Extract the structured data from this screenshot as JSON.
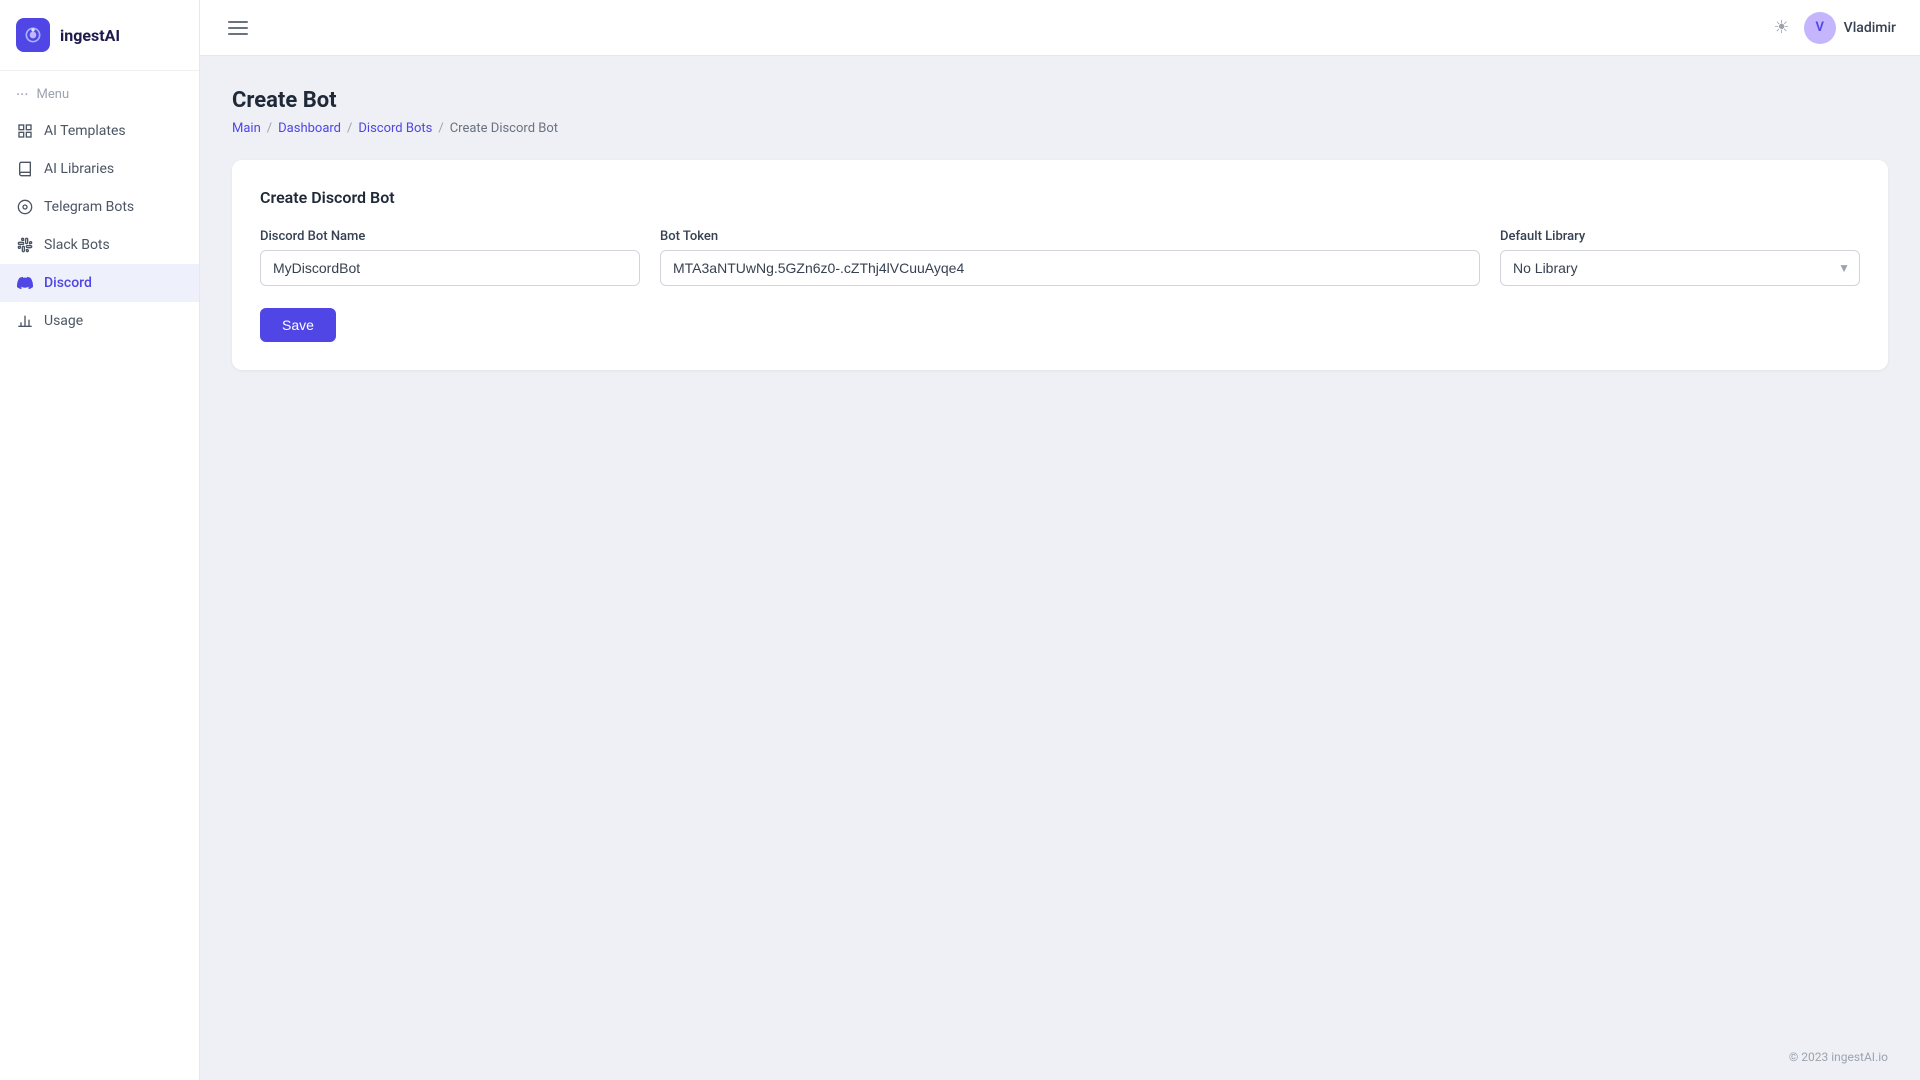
{
  "app": {
    "name": "ingestAI",
    "logo_alt": "ingestAI logo"
  },
  "header": {
    "theme_icon": "☀",
    "user_name": "Vladimir",
    "user_initials": "V"
  },
  "sidebar": {
    "menu_label": "Menu",
    "items": [
      {
        "id": "ai-templates",
        "label": "AI Templates",
        "icon": "grid"
      },
      {
        "id": "ai-libraries",
        "label": "AI Libraries",
        "icon": "book"
      },
      {
        "id": "telegram-bots",
        "label": "Telegram Bots",
        "icon": "circle"
      },
      {
        "id": "slack-bots",
        "label": "Slack Bots",
        "icon": "slack"
      },
      {
        "id": "discord",
        "label": "Discord",
        "icon": "discord",
        "active": true
      },
      {
        "id": "usage",
        "label": "Usage",
        "icon": "bar-chart"
      }
    ]
  },
  "page": {
    "title": "Create Bot",
    "breadcrumb": [
      {
        "label": "Main",
        "link": true
      },
      {
        "label": "Dashboard",
        "link": true
      },
      {
        "label": "Discord Bots",
        "link": true
      },
      {
        "label": "Create Discord Bot",
        "link": false
      }
    ]
  },
  "form": {
    "card_title": "Create Discord Bot",
    "bot_name_label": "Discord Bot Name",
    "bot_name_value": "MyDiscordBot",
    "bot_name_placeholder": "MyDiscordBot",
    "bot_token_label": "Bot Token",
    "bot_token_value": "MTA3aNTUwNg.5GZn6z0-.cZThj4lVCuuAyqe4",
    "bot_token_placeholder": "Bot Token",
    "default_library_label": "Default Library",
    "default_library_value": "No Library",
    "default_library_options": [
      "No Library"
    ],
    "save_button_label": "Save"
  },
  "footer": {
    "copyright": "© 2023 ingestAI.io"
  }
}
